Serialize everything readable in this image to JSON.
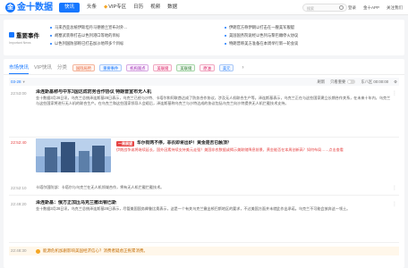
{
  "nav": {
    "logo_mark": "金",
    "logo_text": "金十数据",
    "items": [
      {
        "label": "快讯",
        "active": true
      },
      {
        "label": "头条"
      },
      {
        "label": "VIP专区",
        "vip": true
      },
      {
        "label": "日历"
      },
      {
        "label": "视频"
      },
      {
        "label": "数据"
      }
    ],
    "search_placeholder": "搜索",
    "login": "登录",
    "app": "金十APP",
    "follow": "关注我们"
  },
  "events": {
    "title": "重要事件",
    "subtitle": "Important News",
    "items": [
      "马来西亚总统伊斯坦丹马德德兰宣布对外...",
      "伊朗官方称伊朗以打击在一艘美军舰艇",
      "胡塞武装称打击以色列港口等地的目标",
      "美国国务院说经以色列与黎巴嫩停火协议",
      "以色列国防部称已打击加沙地带多个目标",
      "特朗普称美方准备在本周举行新一轮会谈"
    ]
  },
  "main": {
    "tabs": [
      {
        "label": "市场快讯",
        "active": true
      },
      {
        "label": "VIP快讯",
        "muted": true
      },
      {
        "label": "分类",
        "muted": true
      }
    ],
    "chips": [
      {
        "label": "国际局势",
        "cls": "c1"
      },
      {
        "label": "重要事件",
        "cls": "c2"
      },
      {
        "label": "机构观点",
        "cls": "c3"
      },
      {
        "label": "美联储",
        "cls": "c4"
      },
      {
        "label": "美联储",
        "cls": "c5"
      },
      {
        "label": "原油",
        "cls": "c4"
      },
      {
        "label": "美元",
        "cls": "c2"
      }
    ],
    "date": "03-28",
    "controls": {
      "refresh": "刷新",
      "only_important": "只看重要",
      "auto_refresh": "东八区 00:00:00"
    },
    "items": [
      {
        "time": "22:53:00",
        "title": "泽连斯基称与中东3国达成防务合作协议 特朗普宣布无人机",
        "text": "金十数据3月28日讯，乌克兰总统泽连斯基28日表示，乌克兰已经与沙特、卡塔尔和阿联酋达成了防务合作协议，涉及无人机联合生产等。泽连斯基表示，乌克兰正在与这些国家建立长期合作关系，在未来十年内，乌克兰与这些国家将进行无人机的联合生产。在乌克兰和这些国家领导人会晤后，泽连斯基称乌克兰与沙特达成的协议包括乌克兰向沙特提供无人机拦截技术支持。"
      },
      {
        "time": "22:52:40",
        "red": true,
        "ad_tag": "一周展望",
        "ad_title": "华尔街两不停，非农即将出炉！黄金是否已触顶？",
        "ad_text": "伊朗战争或将继续延长，国外因素持续支持美元走强？美国非农数据或揭示美联储降息前景，黄金能否在本周创新高？如何布局……点击查看"
      },
      {
        "time": "22:52:10",
        "title": "",
        "text": "卡塔尔国防部：卡塔尔与乌克兰在无人机领域合作，将有无人机拦截拦截技术。"
      },
      {
        "time": "22:49:20",
        "title": "泽连斯基：俄方正加压乌克兰撤出顿巴斯",
        "text": "金十数据3月28日讯，乌克兰总统泽连斯基28日表示，尽管美国国务卿鲁比奥表示，这是一个有关乌克兰撤出顿巴斯地区的要求，不过美国方面并未就此作出承诺。乌克兰不可能会放弃这一领土。"
      }
    ],
    "bottom_time": "22:48:30",
    "bottom_text": "能源危机加剧影响美国经济信心？消费者疑虑正拖累消费。"
  }
}
